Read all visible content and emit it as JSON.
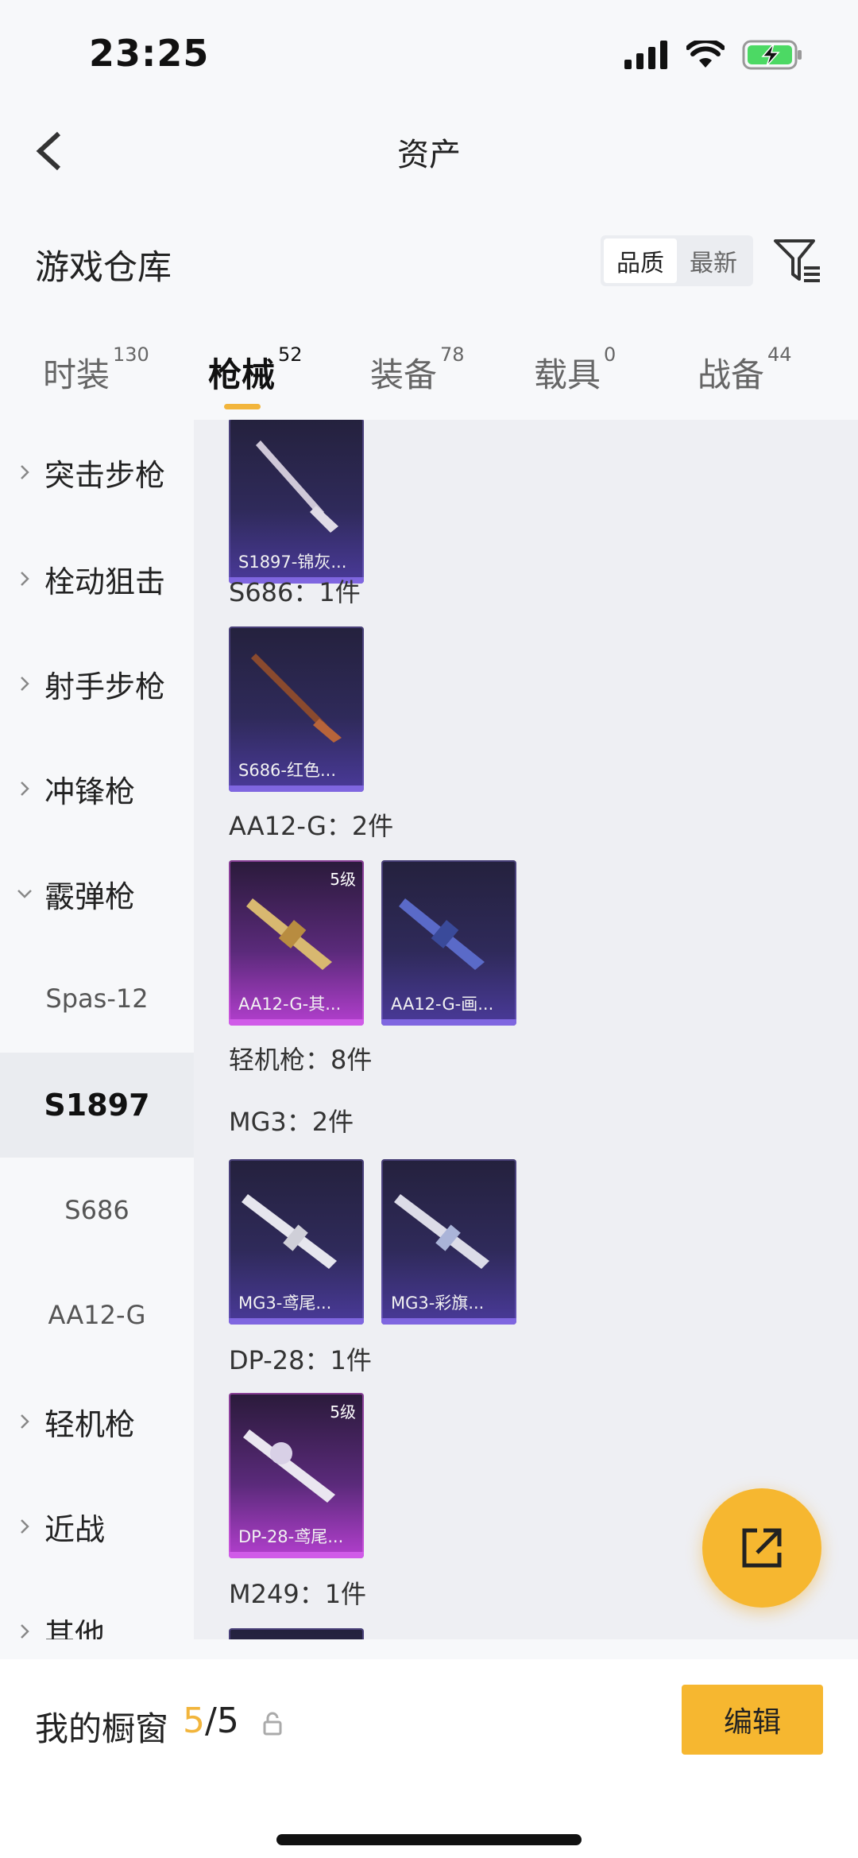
{
  "status_bar": {
    "time": "23:25"
  },
  "nav": {
    "title": "资产"
  },
  "warehouse": {
    "title": "游戏仓库",
    "sort_options": [
      "品质",
      "最新"
    ],
    "sort_active": "品质"
  },
  "tabs": [
    {
      "label": "时装",
      "count": "130",
      "active": false
    },
    {
      "label": "枪械",
      "count": "52",
      "active": true
    },
    {
      "label": "装备",
      "count": "78",
      "active": false
    },
    {
      "label": "载具",
      "count": "0",
      "active": false
    },
    {
      "label": "战备",
      "count": "44",
      "active": false
    }
  ],
  "sidebar": {
    "items": [
      {
        "label": "突击步枪",
        "type": "category",
        "expanded": false
      },
      {
        "label": "栓动狙击",
        "type": "category",
        "expanded": false
      },
      {
        "label": "射手步枪",
        "type": "category",
        "expanded": false
      },
      {
        "label": "冲锋枪",
        "type": "category",
        "expanded": false
      },
      {
        "label": "霰弹枪",
        "type": "category",
        "expanded": true
      },
      {
        "label": "Spas-12",
        "type": "sub",
        "active": false
      },
      {
        "label": "S1897",
        "type": "sub",
        "active": true
      },
      {
        "label": "S686",
        "type": "sub",
        "active": false
      },
      {
        "label": "AA12-G",
        "type": "sub",
        "active": false
      },
      {
        "label": "轻机枪",
        "type": "category",
        "expanded": false
      },
      {
        "label": "近战",
        "type": "category",
        "expanded": false
      },
      {
        "label": "其他",
        "type": "category",
        "expanded": false
      }
    ]
  },
  "content": {
    "groups": [
      {
        "label": "S686：1件"
      },
      {
        "label": "AA12-G：2件"
      },
      {
        "label": "轻机枪：8件"
      },
      {
        "label": "MG3：2件"
      },
      {
        "label": "DP-28：1件"
      },
      {
        "label": "M249：1件"
      }
    ],
    "cards": [
      {
        "caption": "S1897-锦灰...",
        "level": "",
        "rarity": "epic"
      },
      {
        "caption": "S686-红色...",
        "level": "",
        "rarity": "epic"
      },
      {
        "caption": "AA12-G-其...",
        "level": "5级",
        "rarity": "legend"
      },
      {
        "caption": "AA12-G-画...",
        "level": "",
        "rarity": "epic"
      },
      {
        "caption": "MG3-鸢尾...",
        "level": "",
        "rarity": "epic"
      },
      {
        "caption": "MG3-彩旗...",
        "level": "",
        "rarity": "epic"
      },
      {
        "caption": "DP-28-鸢尾...",
        "level": "5级",
        "rarity": "legend"
      }
    ]
  },
  "showcase": {
    "label": "我的橱窗",
    "current": "5",
    "separator": "/",
    "max": "5"
  },
  "actions": {
    "edit_label": "编辑"
  },
  "colors": {
    "accent": "#f6b730",
    "epic": "#7f66e0",
    "legend": "#d05be8"
  },
  "icons": [
    "back-arrow-icon",
    "filter-icon",
    "signal-icon",
    "wifi-icon",
    "battery-icon",
    "share-external-icon",
    "lock-icon",
    "chevron-right-icon",
    "chevron-down-icon"
  ]
}
